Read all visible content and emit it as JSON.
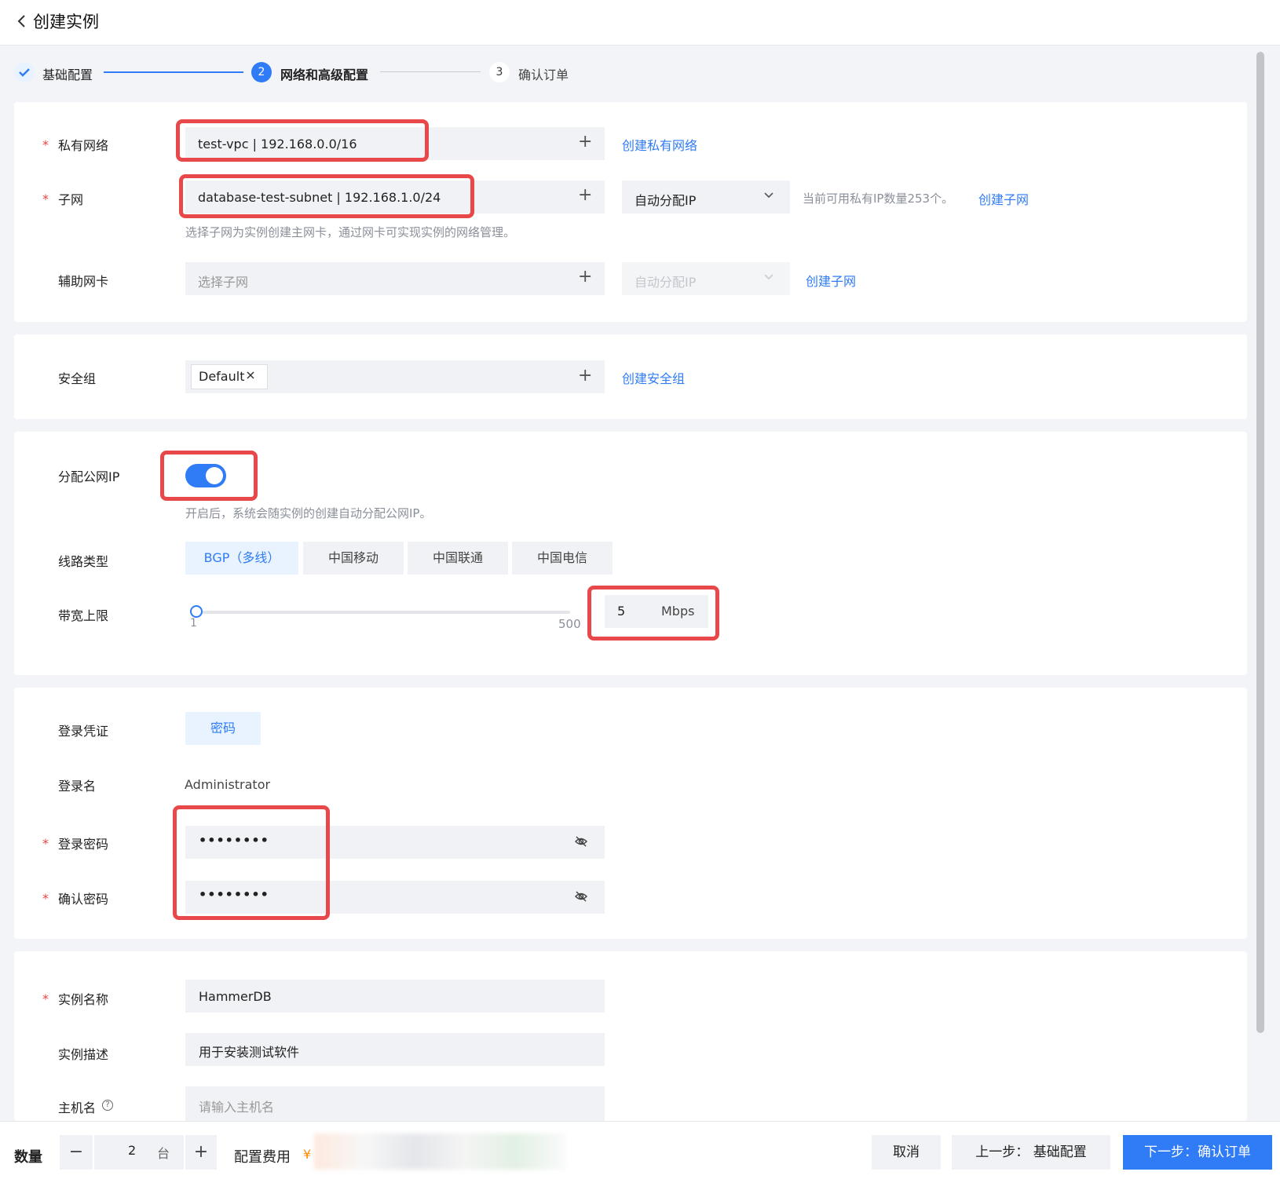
{
  "header": {
    "title": "创建实例"
  },
  "steps": [
    {
      "num": "",
      "label": "基础配置",
      "state": "done"
    },
    {
      "num": "2",
      "label": "网络和高级配置",
      "state": "active"
    },
    {
      "num": "3",
      "label": "确认订单",
      "state": "todo"
    }
  ],
  "network": {
    "vpc_label": "私有网络",
    "vpc_value": "test-vpc | 192.168.0.0/16",
    "vpc_link": "创建私有网络",
    "subnet_label": "子网",
    "subnet_value": "database-test-subnet | 192.168.1.0/24",
    "subnet_ip_mode": "自动分配IP",
    "subnet_available": "当前可用私有IP数量253个。",
    "subnet_link": "创建子网",
    "subnet_hint": "选择子网为实例创建主网卡，通过网卡可实现实例的网络管理。",
    "nic_label": "辅助网卡",
    "nic_placeholder": "选择子网",
    "nic_ip_mode": "自动分配IP",
    "nic_link": "创建子网"
  },
  "security": {
    "label": "安全组",
    "tag": "Default",
    "link": "创建安全组"
  },
  "public_ip": {
    "label": "分配公网IP",
    "enabled": true,
    "hint": "开启后，系统会随实例的创建自动分配公网IP。",
    "line_label": "线路类型",
    "lines": [
      "BGP（多线）",
      "中国移动",
      "中国联通",
      "中国电信"
    ],
    "bandwidth_label": "带宽上限",
    "bandwidth_min": "1",
    "bandwidth_max": "500",
    "bandwidth_value": "5",
    "bandwidth_unit": "Mbps"
  },
  "login": {
    "cred_label": "登录凭证",
    "cred_value": "密码",
    "name_label": "登录名",
    "name_value": "Administrator",
    "pwd_label": "登录密码",
    "pwd_value": "••••••••",
    "confirm_label": "确认密码",
    "confirm_value": "••••••••"
  },
  "instance": {
    "name_label": "实例名称",
    "name_value": "HammerDB",
    "desc_label": "实例描述",
    "desc_value": "用于安装测试软件",
    "host_label": "主机名",
    "host_placeholder": "请输入主机名"
  },
  "footer": {
    "qty_label": "数量",
    "qty_value": "2",
    "qty_unit": "台",
    "fee_label": "配置费用",
    "fee_currency": "¥",
    "cancel": "取消",
    "prev": "上一步：  基础配置",
    "next": "下一步：确认订单"
  },
  "colors": {
    "accent": "#2f7cf6",
    "highlight": "#e8484a",
    "required": "#e54545"
  }
}
